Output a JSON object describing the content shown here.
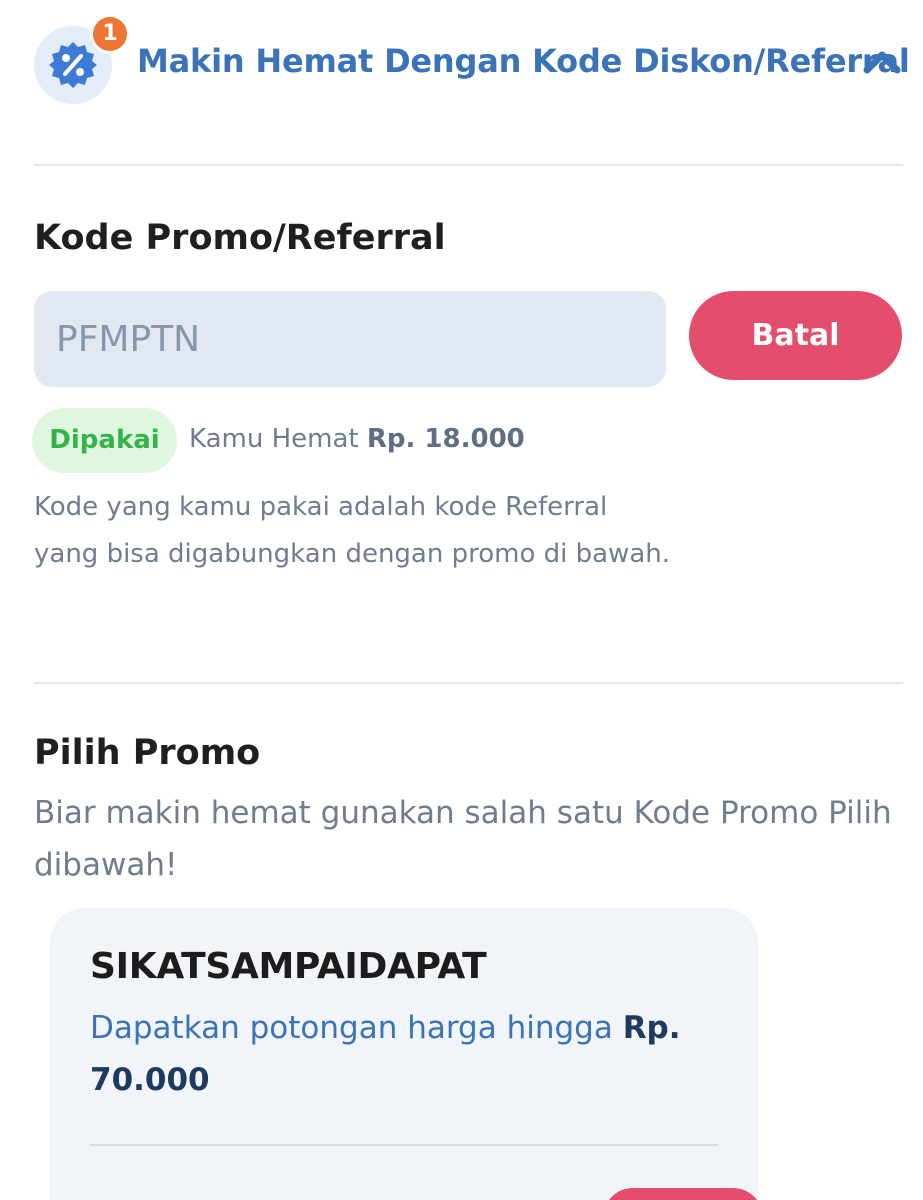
{
  "header": {
    "title": "Makin Hemat Dengan Kode Diskon/Referral",
    "badge_count": "1",
    "icon": "discount-badge-icon",
    "toggle_icon": "chevron-up-icon"
  },
  "promo_section": {
    "title": "Kode Promo/Referral",
    "input_value": "PFMPTN",
    "cancel_label": "Batal",
    "status_label": "Dipakai",
    "savings_prefix": "Kamu Hemat",
    "savings_amount": "Rp. 18.000",
    "note": "Kode yang kamu pakai adalah kode Referral yang bisa digabungkan dengan promo di bawah."
  },
  "choose_section": {
    "title": "Pilih Promo",
    "subtitle": "Biar makin hemat gunakan salah satu Kode Promo Pilih dibawah!"
  },
  "promo_cards": [
    {
      "code": "SIKATSAMPAIDAPAT",
      "desc_prefix": "Dapatkan potongan harga hingga",
      "desc_amount": "Rp. 70.000"
    }
  ],
  "colors": {
    "accent_blue": "#3a73b8",
    "button_red": "#e44d6b",
    "badge_orange": "#ee7633",
    "status_green": "#34b34a"
  }
}
